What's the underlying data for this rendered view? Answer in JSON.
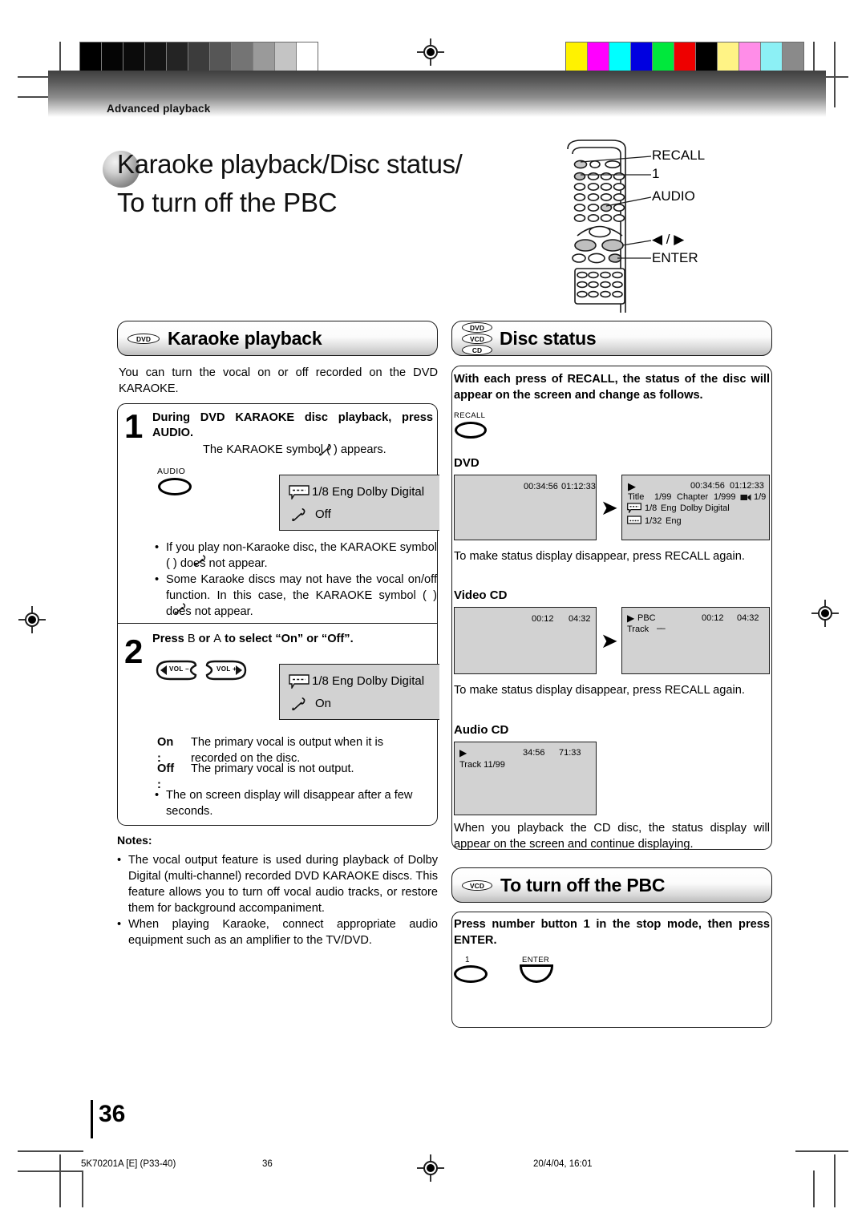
{
  "page": {
    "running_head": "Advanced playback",
    "title_line1": "Karaoke playback/Disc status/",
    "title_line2": "To turn off the PBC",
    "page_number": "36"
  },
  "remote_callouts": [
    {
      "label": "RECALL"
    },
    {
      "label": "1"
    },
    {
      "label": "AUDIO"
    },
    {
      "label": "◀ / ▶"
    },
    {
      "label": "ENTER"
    }
  ],
  "karaoke": {
    "badge": "DVD",
    "heading": "Karaoke playback",
    "intro": "You can turn the vocal on or off recorded on the DVD KARAOKE.",
    "step1": {
      "number": "1",
      "instruction": "During DVD KARAOKE disc playback, press AUDIO.",
      "sub": "The KARAOKE symbol (        ) appears.",
      "button_label": "AUDIO",
      "osd": {
        "line1": "1/8 Eng Dolby Digital",
        "line2": "Off"
      },
      "bullets": [
        "If you play non-Karaoke disc, the KARAOKE symbol (        ) does not appear.",
        "Some Karaoke discs may not have the vocal on/off function. In this case, the KARAOKE symbol (        ) does not appear."
      ]
    },
    "step2": {
      "number": "2",
      "instruction_a": "Press",
      "instruction_b": "B",
      "instruction_c": "or",
      "instruction_d": "A",
      "instruction_e": "to select “On” or “Off”.",
      "vol_minus": "VOL –",
      "vol_plus": "VOL +",
      "osd": {
        "line1": "1/8 Eng Dolby Digital",
        "line2": "On"
      },
      "defs": [
        {
          "term": "On :",
          "desc": "The primary vocal is output when it is recorded on the disc."
        },
        {
          "term": "Off :",
          "desc": "The primary vocal is not output."
        }
      ],
      "bullet": "The on screen display will disappear after a few seconds."
    },
    "notes_heading": "Notes:",
    "notes": [
      "The vocal output feature is used during playback of Dolby Digital (multi-channel) recorded DVD KARAOKE discs. This feature allows you to turn off vocal audio tracks, or restore them for background accompaniment.",
      "When playing Karaoke, connect appropriate audio equipment such as an amplifier to the TV/DVD."
    ]
  },
  "disc_status": {
    "badges": [
      "DVD",
      "VCD",
      "CD"
    ],
    "heading": "Disc status",
    "intro": "With each press of RECALL, the status of the disc will appear on the screen and change as follows.",
    "button_label": "RECALL",
    "sections": [
      {
        "label": "DVD",
        "screen1": {
          "time_elapsed": "00:34:56",
          "time_total": "01:12:33"
        },
        "screen2": {
          "play_icon": "▶",
          "time_elapsed": "00:34:56",
          "time_total": "01:12:33",
          "title_label": "Title",
          "title_value": "1/99",
          "chapter_label": "Chapter",
          "chapter_value": "1/999",
          "angle_value": "1/9",
          "audio_value": "1/8",
          "audio_lang": "Eng",
          "audio_format": "Dolby Digital",
          "subtitle_value": "1/32",
          "subtitle_lang": "Eng"
        },
        "after": "To make status display disappear, press RECALL again."
      },
      {
        "label": "Video CD",
        "screen1": {
          "time_elapsed": "00:12",
          "time_total": "04:32"
        },
        "screen2": {
          "play_icon": "▶",
          "mode": "PBC",
          "time_elapsed": "00:12",
          "time_total": "04:32",
          "track_label": "Track",
          "track_value": "––"
        },
        "after": "To make status display disappear, press RECALL again."
      },
      {
        "label": "Audio CD",
        "screen1": {
          "play_icon": "▶",
          "time_elapsed": "34:56",
          "time_total": "71:33",
          "track_label": "Track 11/99"
        },
        "after": "When you playback the CD disc, the status display will appear on the screen and continue displaying."
      }
    ]
  },
  "pbc": {
    "badge": "VCD",
    "heading": "To turn off the PBC",
    "instruction": "Press number button 1 in the stop mode, then press ENTER.",
    "button1_label": "1",
    "button2_label": "ENTER"
  },
  "footer": {
    "job_code": "5K70201A [E] (P33-40)",
    "folio": "36",
    "timestamp": "20/4/04, 16:01"
  },
  "calibration": {
    "gray_swatches": [
      "#000000",
      "#050505",
      "#0b0b0b",
      "#151515",
      "#242424",
      "#3c3c3c",
      "#565656",
      "#747474",
      "#9a9a9a",
      "#c4c4c4",
      "#ffffff"
    ],
    "color_swatches": [
      "#fff200",
      "#ff00ff",
      "#00ffff",
      "#0000e0",
      "#00e83c",
      "#ee0000",
      "#000000",
      "#fff385",
      "#ff8de8",
      "#8cf0f5",
      "#8a8a8a"
    ]
  }
}
